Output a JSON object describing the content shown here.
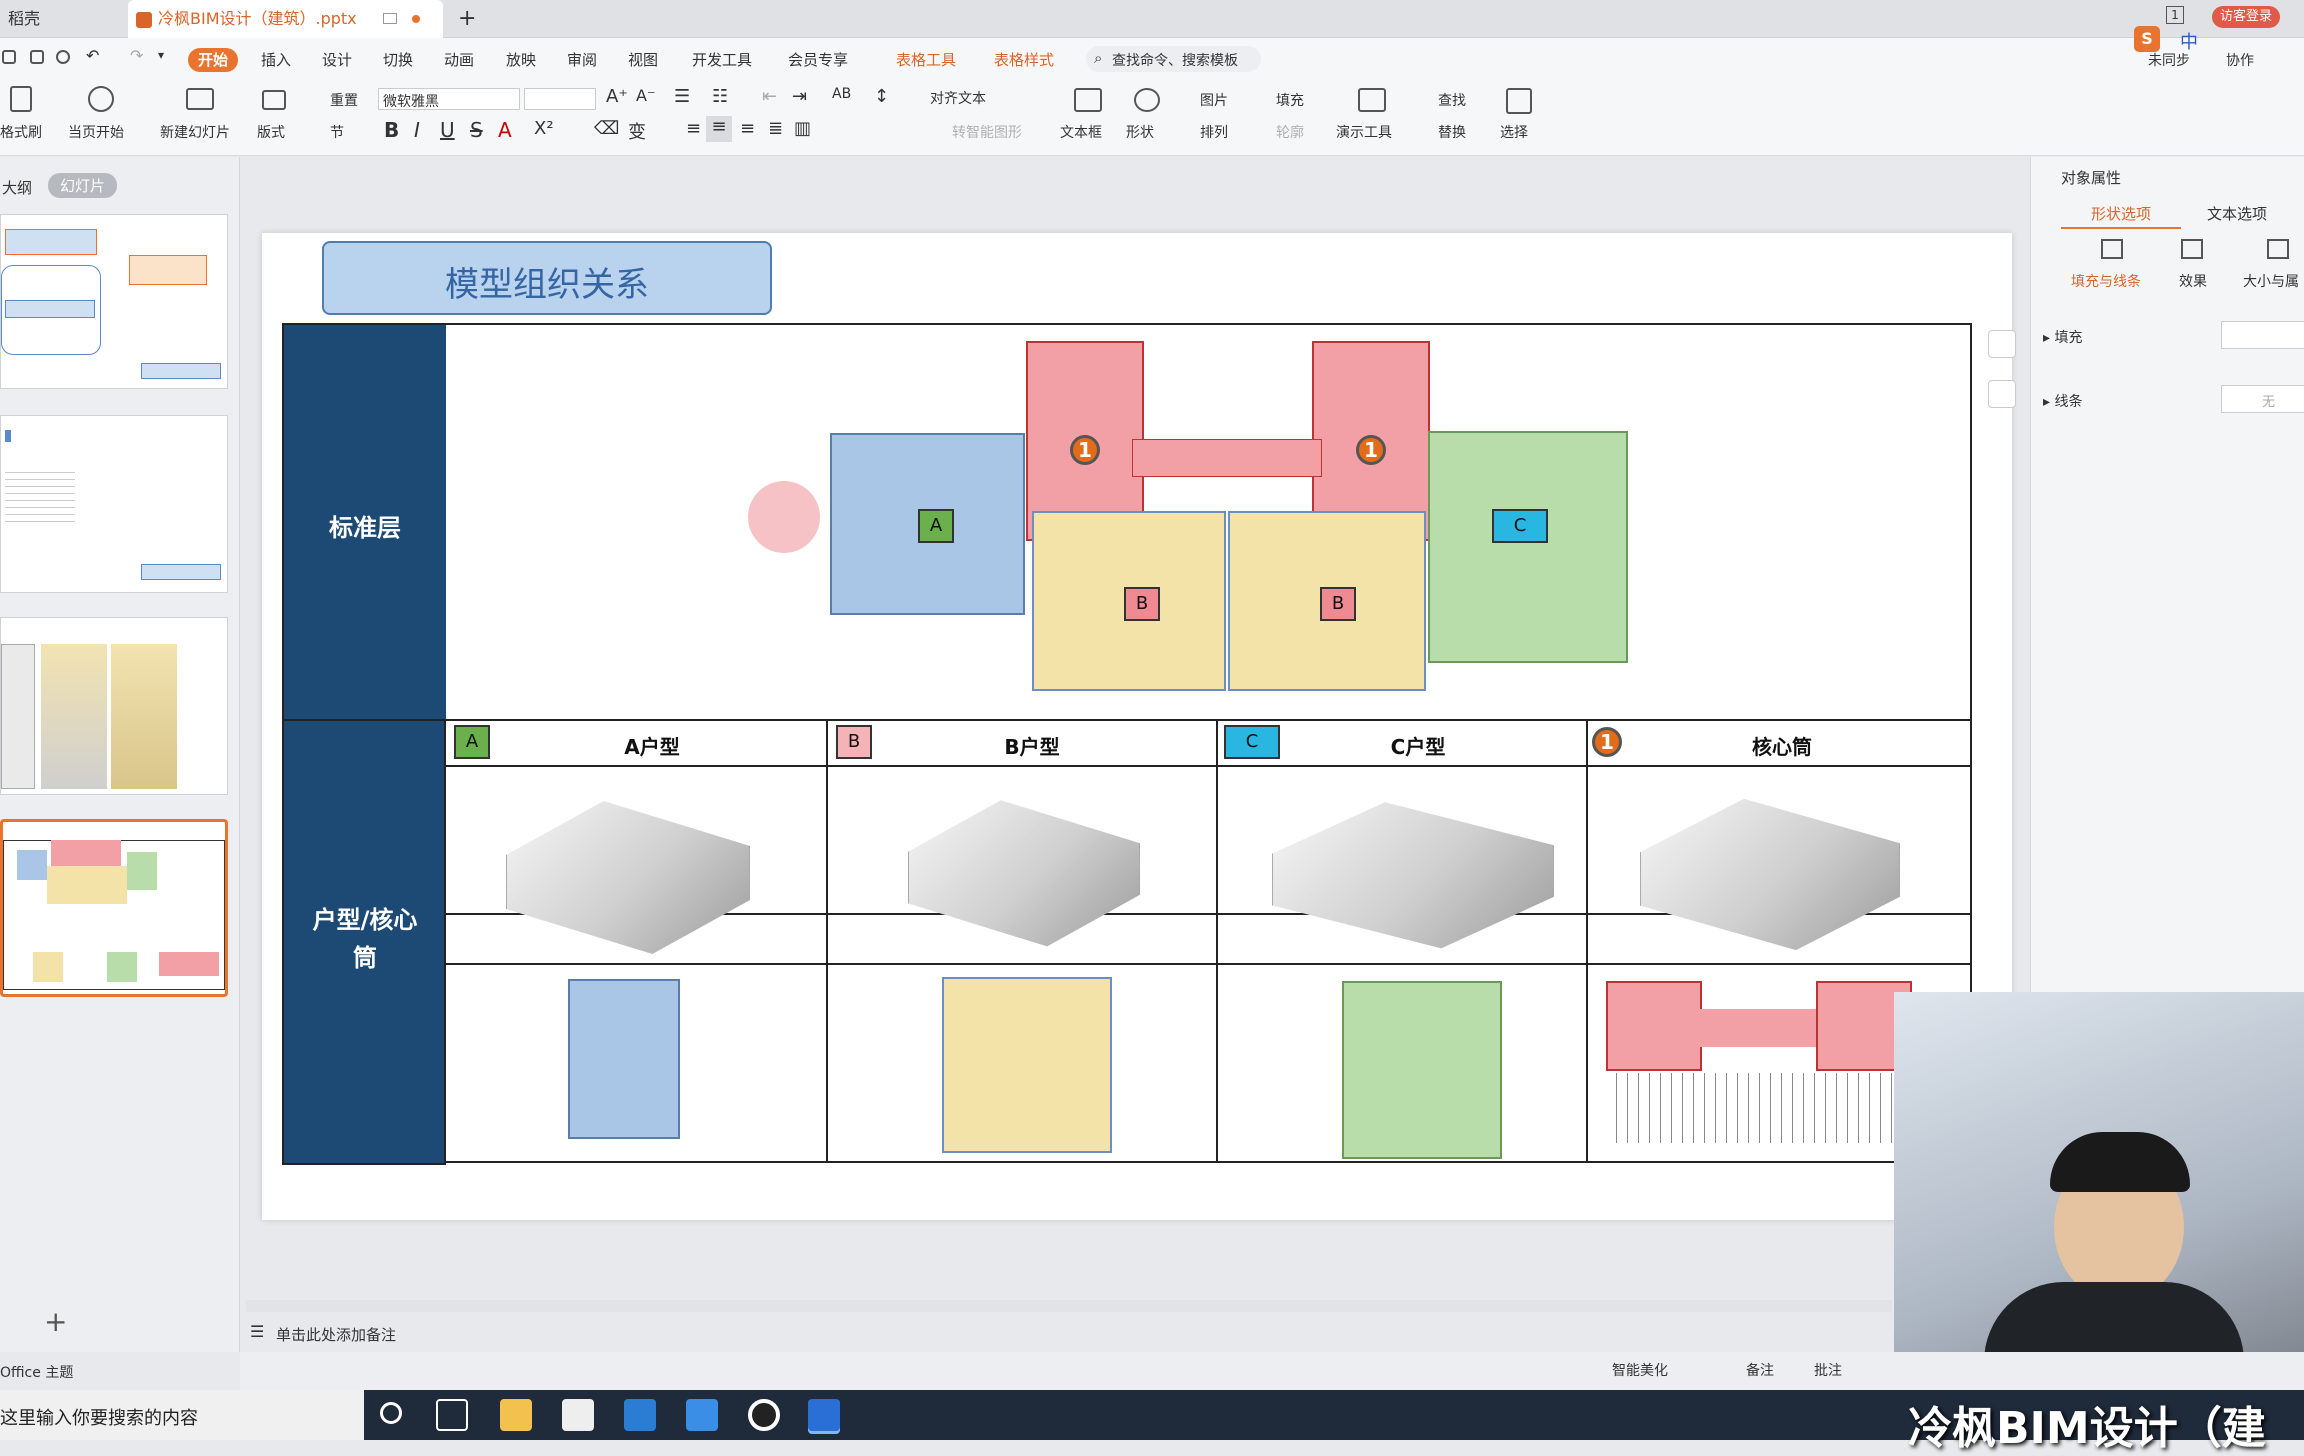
{
  "tabs": {
    "home": "稻壳",
    "doc": "冷枫BIM设计（建筑）.pptx",
    "new": "+",
    "login": "访客登录",
    "page": "1"
  },
  "menu": {
    "items": [
      "开始",
      "插入",
      "设计",
      "切换",
      "动画",
      "放映",
      "审阅",
      "视图",
      "开发工具",
      "会员专享",
      "表格工具",
      "表格样式"
    ],
    "search": "查找命令、搜索模板",
    "sync": "未同步",
    "collab": "协作",
    "ime": "中"
  },
  "ribbon": {
    "format_painter": "格式刷",
    "from_current": "当页开始",
    "new_slide": "新建幻灯片",
    "layout": "版式",
    "section": "节",
    "reset": "重置",
    "font": "微软雅黑",
    "size": "",
    "align_text": "对齐文本",
    "smart_shape": "转智能图形",
    "textbox": "文本框",
    "shape": "形状",
    "picture": "图片",
    "fill": "填充",
    "arrange": "排列",
    "outline": "轮廓",
    "present_tool": "演示工具",
    "find": "查找",
    "replace": "替换",
    "select": "选择"
  },
  "left": {
    "outline": "大纲",
    "slides": "幻灯片",
    "add": "+"
  },
  "slide": {
    "title": "模型组织关系",
    "row1": "标准层",
    "row2": "户型/核心筒",
    "tagA": "A",
    "tagB": "B",
    "tagC": "C",
    "core": "1",
    "cols": [
      {
        "tag": "A",
        "label": "A户型"
      },
      {
        "tag": "B",
        "label": "B户型"
      },
      {
        "tag": "C",
        "label": "C户型"
      },
      {
        "tag": "1",
        "label": "核心筒"
      }
    ]
  },
  "right": {
    "title": "对象属性",
    "tab_shape": "形状选项",
    "tab_text": "文本选项",
    "fill_line": "填充与线条",
    "effect": "效果",
    "size": "大小与属",
    "fill": "填充",
    "line": "线条",
    "none": "无"
  },
  "status": {
    "notes_hint": "单击此处添加备注",
    "theme": "Office 主题",
    "beautify": "智能美化",
    "notes": "备注",
    "comment": "批注"
  },
  "taskbar": {
    "search": "这里输入你要搜索的内容",
    "overlay": "冷枫BIM设计（建"
  },
  "colors": {
    "blueFill": "#a9c6e6",
    "yellowFill": "#f4e3a9",
    "greenFill": "#b8dcaa",
    "redFill": "#f2a0a6",
    "navy": "#1d4a74",
    "orange": "#e8742f"
  }
}
